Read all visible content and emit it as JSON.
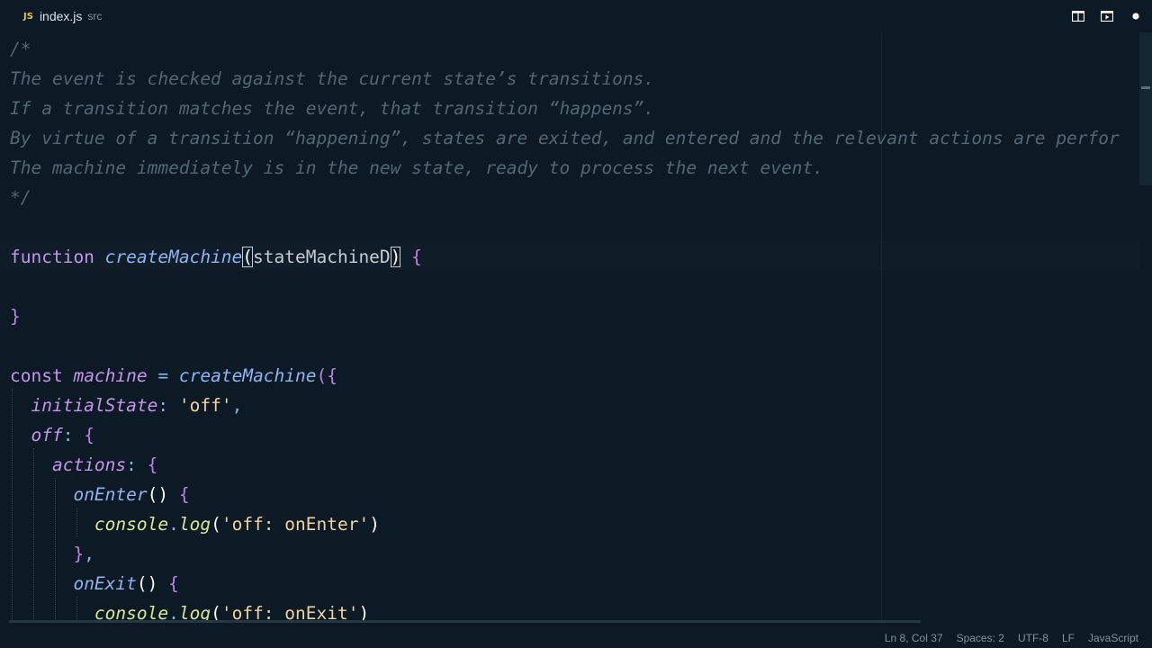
{
  "tab": {
    "icon": "JS",
    "filename": "index.js",
    "directory": "src"
  },
  "titlebar_icons": [
    "split-editor-icon",
    "open-preview-icon",
    "unsaved-dot-icon"
  ],
  "code": {
    "comment_open": "/*",
    "comment_line1": "The event is checked against the current state’s transitions.",
    "comment_line2": "If a transition matches the event, that transition “happens”.",
    "comment_line3": "By virtue of a transition “happening”, states are exited, and entered and the relevant actions are perfor",
    "comment_line4": "The machine immediately is in the new state, ready to process the next event.",
    "comment_close": "*/",
    "fn_keyword": "function",
    "fn_name": "createMachine",
    "fn_param": "stateMachineD",
    "fn_close_brace": "}",
    "const_keyword": "const",
    "const_name": "machine",
    "const_equals": "=",
    "call_name": "createMachine",
    "initial_key": "initialState",
    "initial_value": "'off'",
    "off_key": "off",
    "actions_key": "actions",
    "on_enter": "onEnter",
    "console": "console",
    "log": "log",
    "log_enter": "'off: onEnter'",
    "on_exit": "onExit",
    "log_exit": "'off: onExit'"
  },
  "status": {
    "position": "Ln 8, Col 37",
    "spaces": "Spaces: 2",
    "encoding": "UTF-8",
    "eol": "LF",
    "language": "JavaScript"
  },
  "colors": {
    "background": "#0b1a24",
    "comment": "#546574",
    "keyword": "#c595e8",
    "function": "#8fb4f2",
    "string": "#f1d3a0",
    "console": "#d9e893"
  }
}
